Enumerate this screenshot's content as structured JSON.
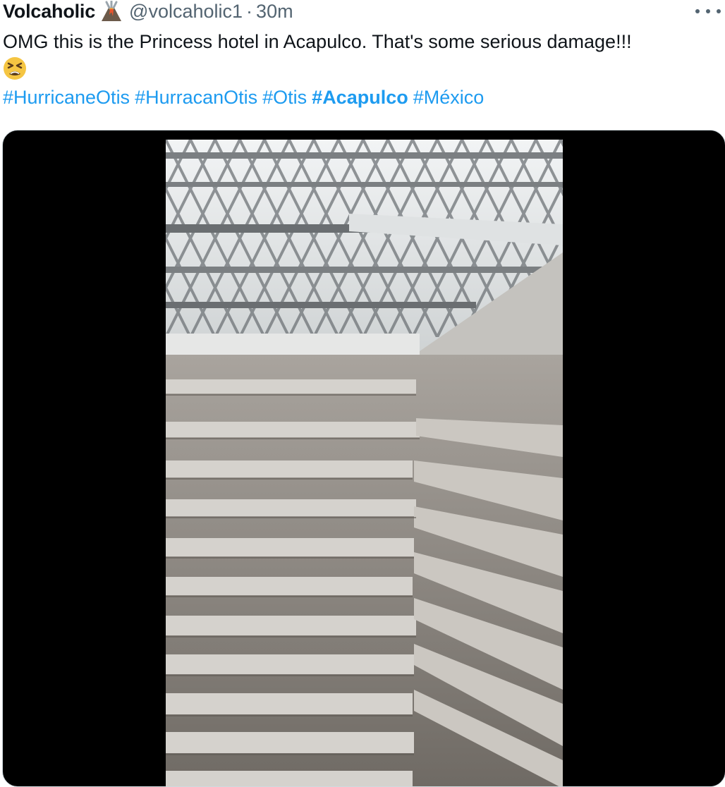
{
  "tweet": {
    "author_name": "Volcaholic",
    "author_emoji": "volcano-emoji",
    "handle": "@volcaholic1",
    "separator": "·",
    "time": "30m",
    "text": "OMG this is the Princess hotel in Acapulco. That's some serious damage!!!",
    "text_emoji": "tired-face-emoji",
    "hashtags": [
      {
        "label": "#HurricaneOtis",
        "bold": false
      },
      {
        "label": "#HurracanOtis",
        "bold": false
      },
      {
        "label": "#Otis",
        "bold": false
      },
      {
        "label": "#Acapulco",
        "bold": true
      },
      {
        "label": "#México",
        "bold": false
      }
    ]
  },
  "colors": {
    "text": "#0f1419",
    "secondary": "#536471",
    "link": "#1d9bf0",
    "media_bg": "#000000"
  },
  "media": {
    "type": "video",
    "description_icon": "video-thumbnail"
  }
}
